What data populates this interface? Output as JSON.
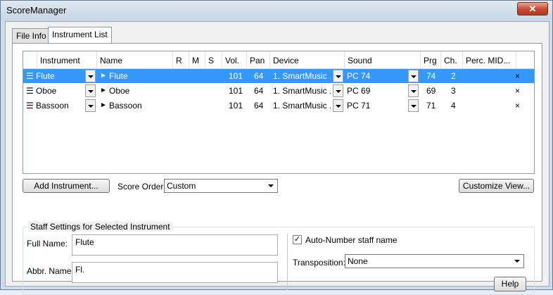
{
  "window": {
    "title": "ScoreManager",
    "close_label": "✕"
  },
  "tabs": [
    {
      "label": "File Info"
    },
    {
      "label": "Instrument List"
    }
  ],
  "grid": {
    "columns": [
      "Instrument",
      "Name",
      "R",
      "M",
      "S",
      "Vol.",
      "Pan",
      "Device",
      "Sound",
      "Prg",
      "Ch.",
      "Perc. MID..."
    ],
    "rows": [
      {
        "instrument": "Flute",
        "name": "Flute",
        "vol": "101",
        "pan": "64",
        "device": "1. SmartMusic ...",
        "sound": "PC 74",
        "prg": "74",
        "ch": "2",
        "delete": "×"
      },
      {
        "instrument": "Oboe",
        "name": "Oboe",
        "vol": "101",
        "pan": "64",
        "device": "1. SmartMusic ...",
        "sound": "PC 69",
        "prg": "69",
        "ch": "3",
        "delete": "×"
      },
      {
        "instrument": "Bassoon",
        "name": "Bassoon",
        "vol": "101",
        "pan": "64",
        "device": "1. SmartMusic ...",
        "sound": "PC 71",
        "prg": "71",
        "ch": "4",
        "delete": "×"
      }
    ],
    "drag_glyph": "☰",
    "expand_glyph": "►"
  },
  "add_instrument_label": "Add Instrument...",
  "score_order": {
    "label": "Score Order:",
    "value": "Custom"
  },
  "customize_view_label": "Customize View...",
  "staff_settings": {
    "title": "Staff Settings for Selected Instrument",
    "full_name_label": "Full Name:",
    "full_name_value": "Flute",
    "abbr_name_label": "Abbr. Name:",
    "abbr_name_value": "Fl.",
    "auto_number_label": "Auto-Number staff name",
    "auto_number_checked": "✓",
    "transposition_label": "Transposition:",
    "transposition_value": "None",
    "help_label": "Help"
  }
}
